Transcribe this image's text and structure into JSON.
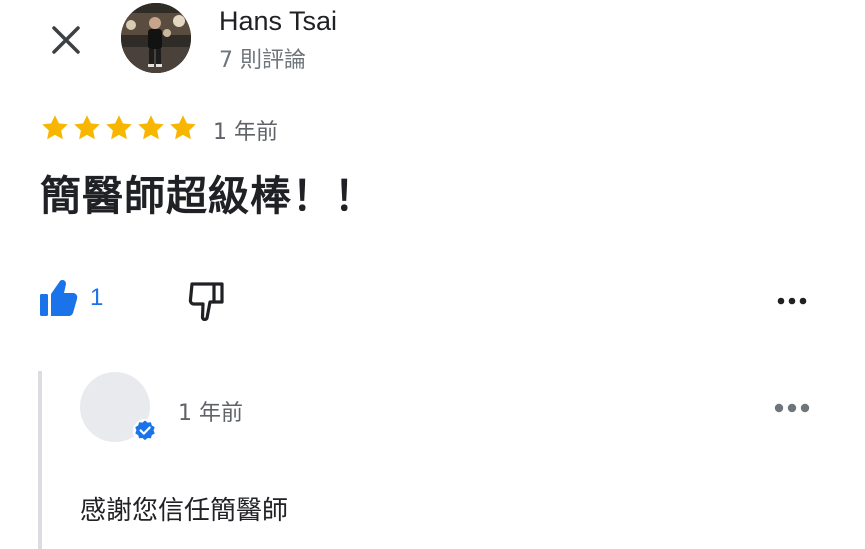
{
  "review": {
    "author_name": "Hans Tsai",
    "author_review_count": "7 則評論",
    "rating": 5,
    "rating_max": 5,
    "time": "1 年前",
    "text": "簡醫師超級棒！！",
    "like_count": "1"
  },
  "reply": {
    "time": "1 年前",
    "text": "感謝您信任簡醫師"
  },
  "icons": {
    "close": "close-icon",
    "like": "thumbs-up-icon",
    "dislike": "thumbs-down-icon",
    "more": "more-horizontal-icon",
    "verified": "verified-badge-icon",
    "star": "star-icon"
  },
  "colors": {
    "star": "#f9b600",
    "like": "#1a73e8",
    "verified": "#1a73e8",
    "reply_border": "#dadce0"
  }
}
